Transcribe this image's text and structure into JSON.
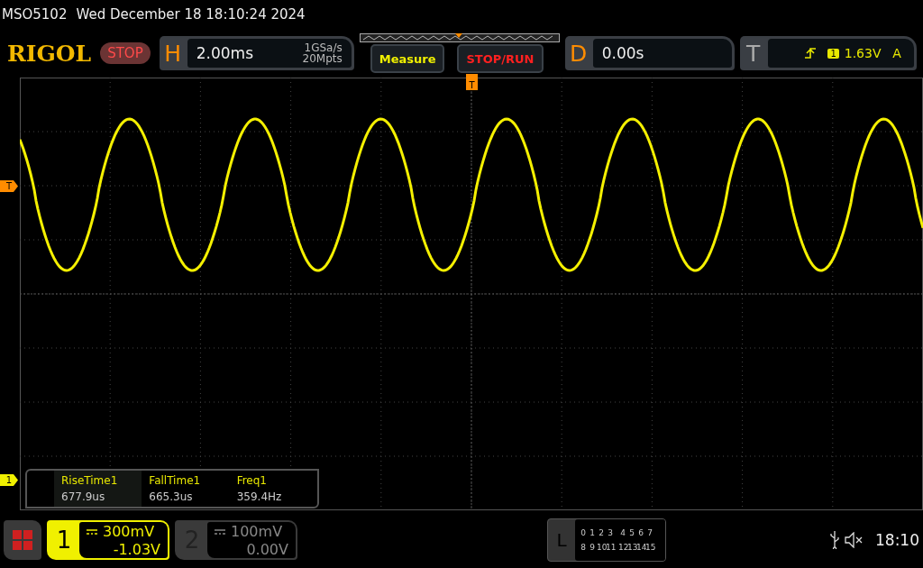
{
  "title_bar": {
    "model": "MSO5102",
    "datetime": "Wed December 18 18:10:24 2024"
  },
  "header": {
    "logo": "RIGOL",
    "run_state": "STOP",
    "horizontal": {
      "label": "H",
      "timebase": "2.00ms",
      "sample_rate": "1GSa/s",
      "memory_depth": "20Mpts"
    },
    "buttons": [
      "Measure",
      "STOP/RUN"
    ],
    "delay": {
      "label": "D",
      "value": "0.00s"
    },
    "trigger": {
      "label": "T",
      "source": "1",
      "level": "1.63V",
      "mode": "A"
    }
  },
  "markers": {
    "trigger_level": "T",
    "trigger_position": "T",
    "channel": "1"
  },
  "measurements": [
    {
      "name": "RiseTime1",
      "value": "677.9us"
    },
    {
      "name": "FallTime1",
      "value": "665.3us"
    },
    {
      "name": "Freq1",
      "value": "359.4Hz"
    }
  ],
  "channels": [
    {
      "number": "1",
      "scale": "300mV",
      "offset": "-1.03V",
      "on": true
    },
    {
      "number": "2",
      "scale": "100mV",
      "offset": "0.00V",
      "on": false
    }
  ],
  "logic": {
    "label": "L",
    "rows": [
      [
        "0",
        "1",
        "2",
        "3",
        "4",
        "5",
        "6",
        "7"
      ],
      [
        "8",
        "9",
        "10",
        "11",
        "12",
        "13",
        "14",
        "15"
      ]
    ]
  },
  "status": {
    "time": "18:10"
  }
}
